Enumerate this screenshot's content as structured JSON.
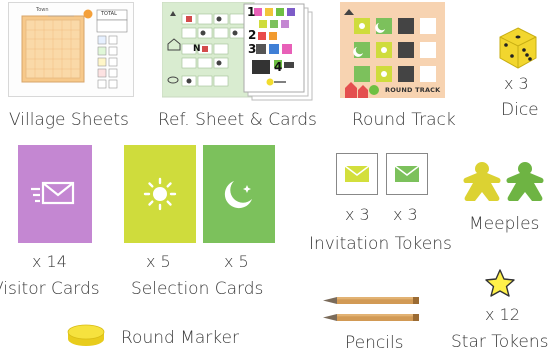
{
  "components": {
    "village_sheets": {
      "label": "Village Sheets",
      "sheet_town": "Town",
      "sheet_total": "TOTAL"
    },
    "reference": {
      "label": "Ref. Sheet & Cards",
      "card_numbers": [
        "1",
        "2",
        "3",
        "4"
      ],
      "ref_n": "N"
    },
    "round_track": {
      "label": "Round Track",
      "caption": "ROUND TRACK"
    },
    "dice": {
      "count": "x 3",
      "label": "Dice"
    },
    "visitor_cards": {
      "count": "x 14",
      "label": "Visitor Cards"
    },
    "selection_cards": {
      "count_left": "x 5",
      "count_right": "x 5",
      "label": "Selection Cards"
    },
    "invitation_tokens": {
      "count_left": "x 3",
      "count_right": "x 3",
      "label": "Invitation Tokens"
    },
    "meeples": {
      "label": "Meeples"
    },
    "star_tokens": {
      "count": "x 12",
      "label": "Star Tokens"
    },
    "round_marker": {
      "label": "Round Marker"
    },
    "pencils": {
      "label": "Pencils"
    }
  },
  "colors": {
    "visitor_card": "#c487d2",
    "selection_yellow": "#cfdc3c",
    "selection_green": "#7cc15c",
    "meeple_yellow": "#dcd232",
    "meeple_green": "#6eb443",
    "star": "#fff14a",
    "marker": "#f2dc2e",
    "pencil": "#d29a55"
  }
}
